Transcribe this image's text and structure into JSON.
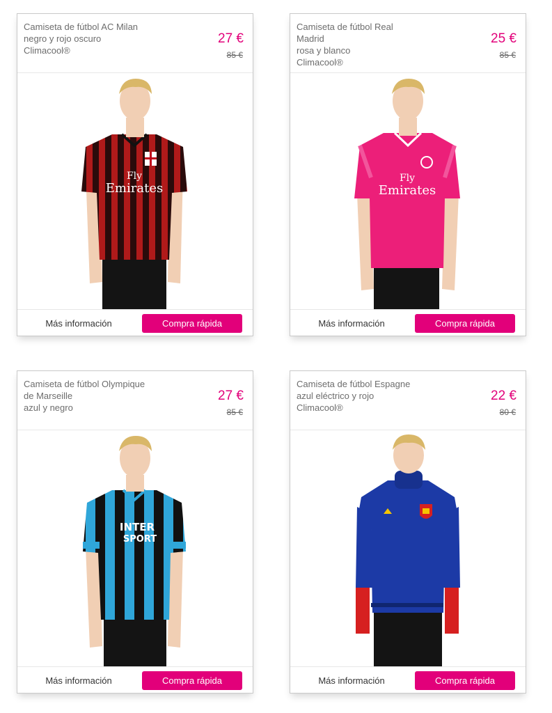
{
  "products": [
    {
      "name": "Camiseta de fútbol AC Milan\nnegro y rojo oscuro\nClimacool®",
      "price": "27 €",
      "old_price": "85 €",
      "shirt_colors": [
        "#2a0b0b",
        "#b01a1a"
      ],
      "sponsor": "Fly\nEmirates",
      "more_label": "Más información",
      "buy_label": "Compra rápida"
    },
    {
      "name": "Camiseta de fútbol Real\nMadrid\nrosa y blanco\nClimacool®",
      "price": "25 €",
      "old_price": "85 €",
      "shirt_colors": [
        "#ec1f79",
        "#f2559c"
      ],
      "sponsor": "Fly\nEmirates",
      "more_label": "Más información",
      "buy_label": "Compra rápida"
    },
    {
      "name": "Camiseta de fútbol Olympique\nde Marseille\nazul y negro",
      "price": "27 €",
      "old_price": "85 €",
      "shirt_colors": [
        "#111111",
        "#2fa6d9"
      ],
      "sponsor": "INTER\nSPORT",
      "more_label": "Más información",
      "buy_label": "Compra rápida"
    },
    {
      "name": "Camiseta de fútbol Espagne\nazul eléctrico y rojo\nClimacool®",
      "price": "22 €",
      "old_price": "80 €",
      "shirt_colors": [
        "#1c3aa6",
        "#d62020"
      ],
      "sponsor": "",
      "more_label": "Más información",
      "buy_label": "Compra rápida"
    }
  ],
  "colors": {
    "accent": "#e2007a",
    "skin": "#f1cfb4",
    "hair": "#d9b768"
  }
}
